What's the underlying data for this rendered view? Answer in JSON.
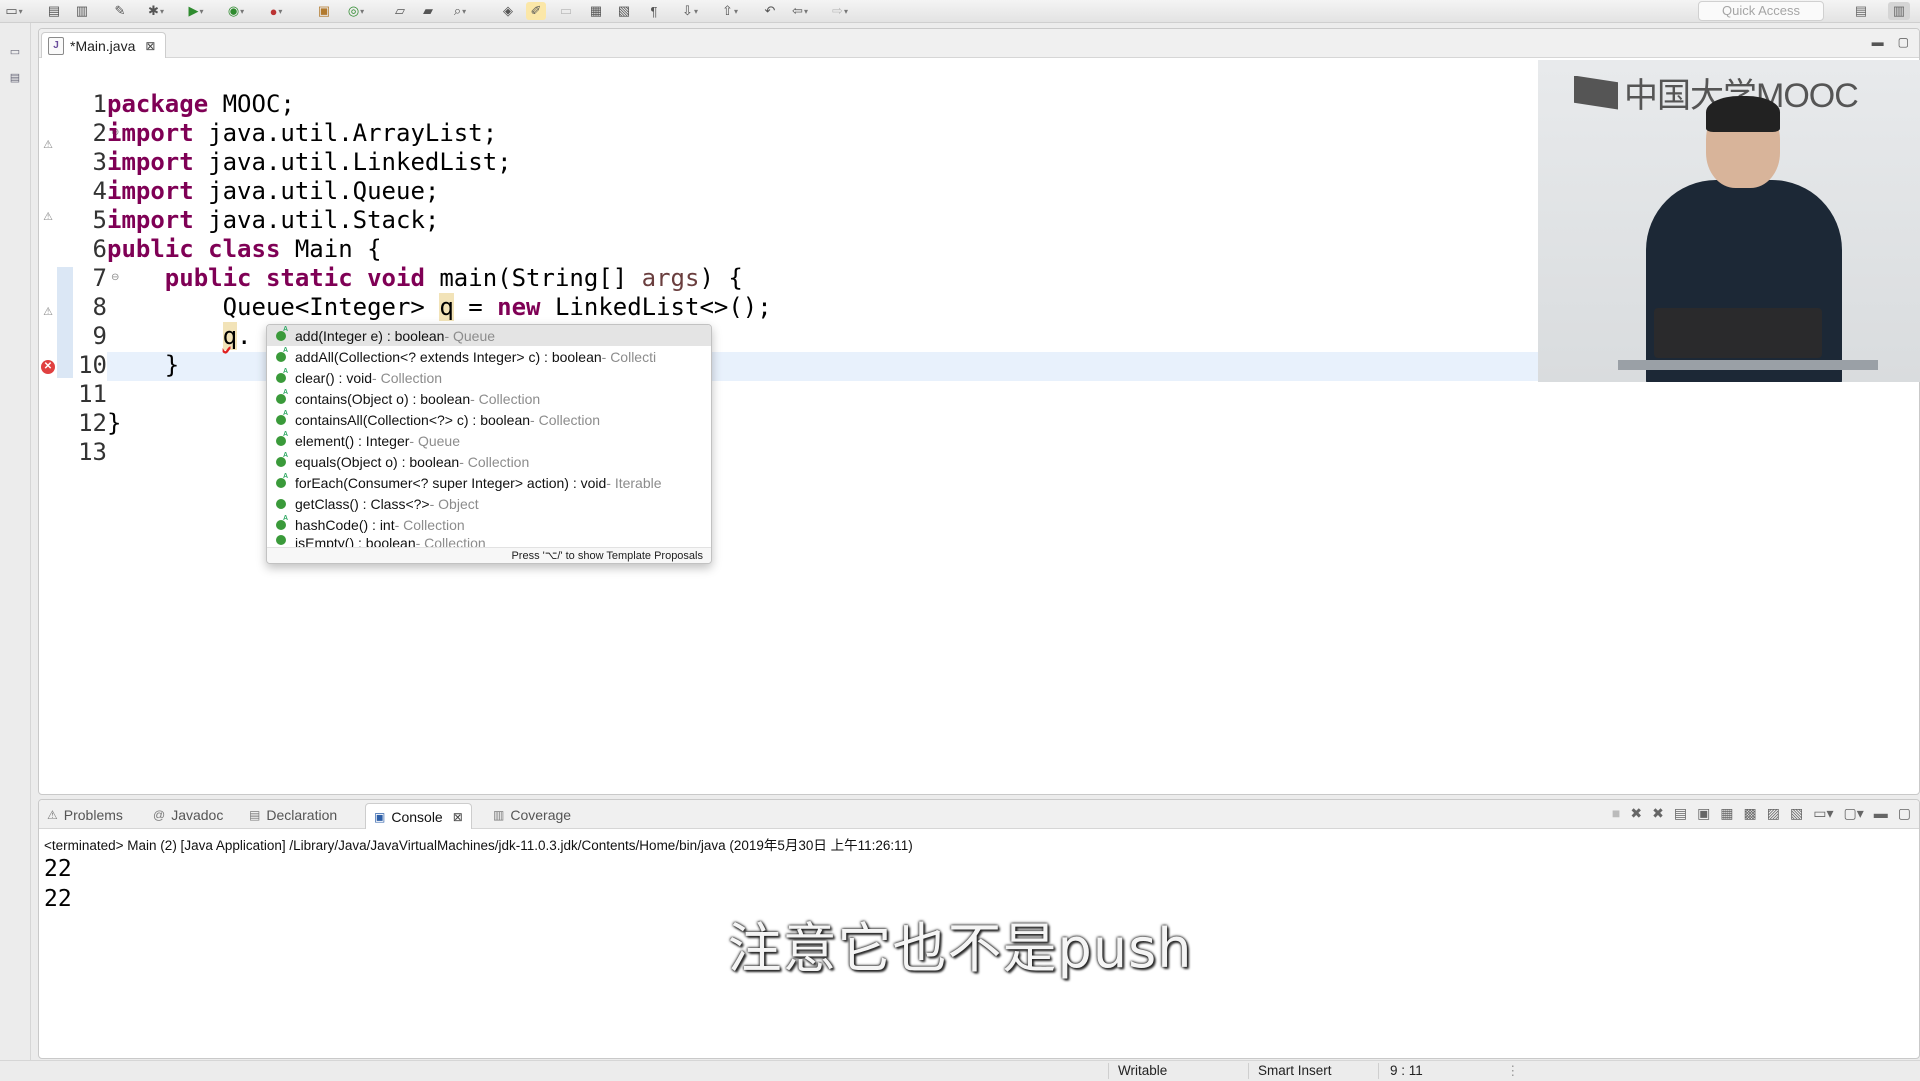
{
  "toolbar": {
    "quick_access_placeholder": "Quick Access",
    "icons": [
      "new-icon",
      "save-icon",
      "save-all-icon",
      "pin-icon",
      "debug-icon",
      "run-icon",
      "run-coverage-icon",
      "external-tools-icon",
      "new-java-package-icon",
      "new-java-class-icon",
      "open-type-icon",
      "open-task-icon",
      "search-icon",
      "toggle-mark-icon",
      "annotation-icon",
      "show-whitespace-icon",
      "next-annotation-icon",
      "prev-annotation-icon",
      "back-icon",
      "forward-icon"
    ]
  },
  "editor": {
    "tab_title": "*Main.java",
    "lines": [
      {
        "no": "1"
      },
      {
        "no": "2"
      },
      {
        "no": "3"
      },
      {
        "no": "4"
      },
      {
        "no": "5"
      },
      {
        "no": "6"
      },
      {
        "no": "7"
      },
      {
        "no": "8"
      },
      {
        "no": "9"
      },
      {
        "no": "10"
      },
      {
        "no": "11"
      },
      {
        "no": "12"
      },
      {
        "no": "13"
      }
    ],
    "code": {
      "l1_kw": "package",
      "l1_rest": " MOOC;",
      "l2_kw": "import",
      "l2_rest": " java.util.ArrayList;",
      "l3_kw": "import",
      "l3_rest": " java.util.LinkedList;",
      "l4_kw": "import",
      "l4_rest": " java.util.Queue;",
      "l5_kw": "import",
      "l5_rest": " java.util.Stack;",
      "l6_kw1": "public",
      "l6_kw2": "class",
      "l6_rest": " Main {",
      "l7_kw1": "public",
      "l7_kw2": "static",
      "l7_kw3": "void",
      "l7_mid": " main(String[] ",
      "l7_param": "args",
      "l7_end": ") {",
      "l8_a": "Queue<Integer> ",
      "l8_var": "q",
      "l8_b": " = ",
      "l8_kw": "new",
      "l8_c": " LinkedList<>();",
      "l9_var": "q",
      "l9_dot": ".",
      "l10": "}",
      "l12": "}"
    }
  },
  "content_assist": {
    "items": [
      {
        "sig": "add(Integer e) : boolean",
        "owner": " - Queue",
        "selected": true
      },
      {
        "sig": "addAll(Collection<? extends Integer> c) : boolean",
        "owner": " - Collecti"
      },
      {
        "sig": "clear() : void",
        "owner": " - Collection"
      },
      {
        "sig": "contains(Object o) : boolean",
        "owner": " - Collection"
      },
      {
        "sig": "containsAll(Collection<?> c) : boolean",
        "owner": " - Collection"
      },
      {
        "sig": "element() : Integer",
        "owner": " - Queue"
      },
      {
        "sig": "equals(Object o) : boolean",
        "owner": " - Collection"
      },
      {
        "sig": "forEach(Consumer<? super Integer> action) : void",
        "owner": " - Iterable"
      },
      {
        "sig": "getClass() : Class<?>",
        "owner": " - Object"
      },
      {
        "sig": "hashCode() : int",
        "owner": " - Collection"
      },
      {
        "sig": "isEmpty() : boolean",
        "owner": " - Collection"
      }
    ],
    "hint": "Press '⌥/' to show Template Proposals"
  },
  "video": {
    "logo_text": "中国大学MOOC"
  },
  "bottom_panel": {
    "tabs": [
      {
        "label": "Problems",
        "icon": "problems-icon"
      },
      {
        "label": "Javadoc",
        "icon": "javadoc-icon"
      },
      {
        "label": "Declaration",
        "icon": "declaration-icon"
      },
      {
        "label": "Console",
        "icon": "console-icon",
        "active": true
      },
      {
        "label": "Coverage",
        "icon": "coverage-icon"
      }
    ],
    "console_header": "<terminated> Main (2) [Java Application] /Library/Java/JavaVirtualMachines/jdk-11.0.3.jdk/Contents/Home/bin/java (2019年5月30日 上午11:26:11)",
    "output": [
      "22",
      "22"
    ]
  },
  "subtitle": "注意它也不是push",
  "statusbar": {
    "writable": "Writable",
    "insert_mode": "Smart Insert",
    "position": "9 : 11"
  }
}
